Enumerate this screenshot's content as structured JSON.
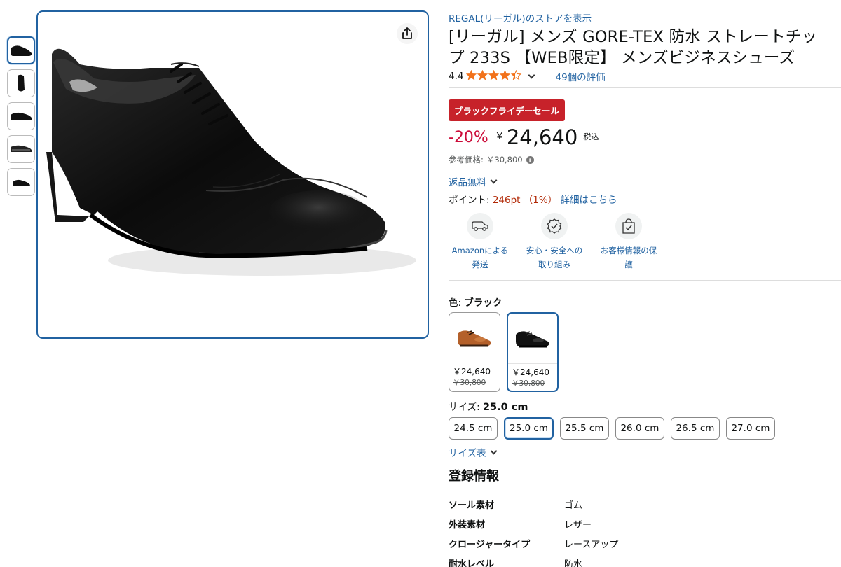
{
  "product": {
    "store_link": "REGAL(リーガル)のストアを表示",
    "title_line1": "[リーガル] メンズ GORE-TEX 防水 ストレートチッ",
    "title_line2": "プ 233S 【WEB限定】 メンズビジネスシューズ"
  },
  "rating": {
    "value": "4.4",
    "stars": 4.4,
    "review_count": "49個の評価"
  },
  "deal_badge": "ブラックフライデーセール",
  "price": {
    "discount": "-20%",
    "currency": "￥",
    "amount": "24,640",
    "tax_label": "税込",
    "ref_label": "参考価格:",
    "ref_price": "￥30,800",
    "info_icon": "i"
  },
  "returns": "返品無料",
  "points": {
    "label": "ポイント: ",
    "value": "246pt （1%）",
    "details_link": "詳細はこちら"
  },
  "features": [
    {
      "icon": "delivery-truck-icon",
      "label": "Amazonによる発送"
    },
    {
      "icon": "safety-badge-icon",
      "label": "安心・安全への取り組み"
    },
    {
      "icon": "secure-bag-icon",
      "label": "お客様情報の保護"
    }
  ],
  "color": {
    "label": "色: ",
    "selected": "ブラック",
    "options": [
      {
        "name": "brown",
        "price": "￥24,640",
        "old_price": "￥30,800"
      },
      {
        "name": "black",
        "price": "￥24,640",
        "old_price": "￥30,800"
      }
    ]
  },
  "size": {
    "label": "サイズ: ",
    "selected": "25.0 cm",
    "options": [
      "24.5 cm",
      "25.0 cm",
      "25.5 cm",
      "26.0 cm",
      "26.5 cm",
      "27.0 cm"
    ],
    "chart_link": "サイズ表"
  },
  "registration": {
    "title": "登録情報",
    "rows": [
      {
        "key": "ソール素材",
        "value": "ゴム"
      },
      {
        "key": "外装素材",
        "value": "レザー"
      },
      {
        "key": "クロージャータイプ",
        "value": "レースアップ"
      },
      {
        "key": "耐水レベル",
        "value": "防水"
      }
    ]
  },
  "colors": {
    "link": "#2162a1",
    "deal_red": "#c7222a",
    "discount_red": "#cc0c39",
    "star": "#f2721b"
  }
}
